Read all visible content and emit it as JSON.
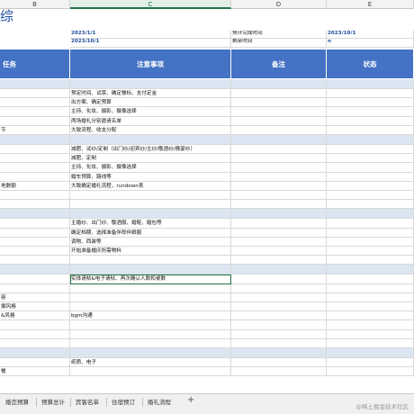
{
  "columns": [
    "B",
    "C",
    "D",
    "E"
  ],
  "active_column": "C",
  "title": "综",
  "info": {
    "start_date": "2023/1/1",
    "planned_end_label": "预计完成时间",
    "planned_end": "2023/10/1",
    "current_date": "2023/10/1",
    "remaining_label": "剩余时间",
    "remaining": "n"
  },
  "headers": {
    "task": "任务",
    "notes": "注意事项",
    "remark": "备注",
    "status": "状态"
  },
  "rows": [
    {
      "type": "section"
    },
    {
      "b": "",
      "c": "预定时间、试菜、确定餐标、支付定金"
    },
    {
      "b": "",
      "c": "出方案、确定预算"
    },
    {
      "b": "",
      "c": "主持、化妆、摄影、摄像选择"
    },
    {
      "b": "",
      "c": "两场婚礼分别邀请名单"
    },
    {
      "b": "节",
      "c": "大致流程、收支分配"
    },
    {
      "type": "section"
    },
    {
      "b": "",
      "c": "减肥、试纱/定制（出门纱/迎宾纱/主纱/敬酒纱/晚宴纱）"
    },
    {
      "b": "",
      "c": "减肥、定制"
    },
    {
      "b": "",
      "c": "主持、化妆、摄影、摄像选择"
    },
    {
      "b": "",
      "c": "婚车预算、路线等"
    },
    {
      "b": "地数额",
      "c": "大致确定婚礼流程，rundown表"
    },
    {
      "b": "",
      "c": ""
    },
    {
      "b": "",
      "c": ""
    },
    {
      "type": "section"
    },
    {
      "b": "",
      "c": "主婚纱、出门纱、敬酒服、婚鞋、婚包等"
    },
    {
      "b": "",
      "c": "确定档期、选择准备伴郎伴娘服"
    },
    {
      "b": "",
      "c": "调物、西装等"
    },
    {
      "b": "",
      "c": "开始准备婚庆所需物料"
    },
    {
      "b": "",
      "c": ""
    },
    {
      "type": "section"
    },
    {
      "b": "",
      "c": "实体请帖&电子请帖、再次确认人数和桌数",
      "selected": true
    },
    {
      "b": "",
      "c": ""
    },
    {
      "b": "容",
      "c": ""
    },
    {
      "b": "摄风格",
      "c": ""
    },
    {
      "b": "&风格",
      "c": "bgm沟通"
    },
    {
      "b": "",
      "c": ""
    },
    {
      "b": "",
      "c": ""
    },
    {
      "b": "",
      "c": ""
    },
    {
      "type": "section"
    },
    {
      "b": "",
      "c": "纸质、电子"
    },
    {
      "b": "餐",
      "c": ""
    }
  ],
  "sheet_tabs": [
    "婚恋预算",
    "预算总计",
    "宾客名单",
    "住宿预订",
    "婚礼流程"
  ],
  "add_tab_symbol": "+",
  "watermark": "@稀土掘金技术社区"
}
